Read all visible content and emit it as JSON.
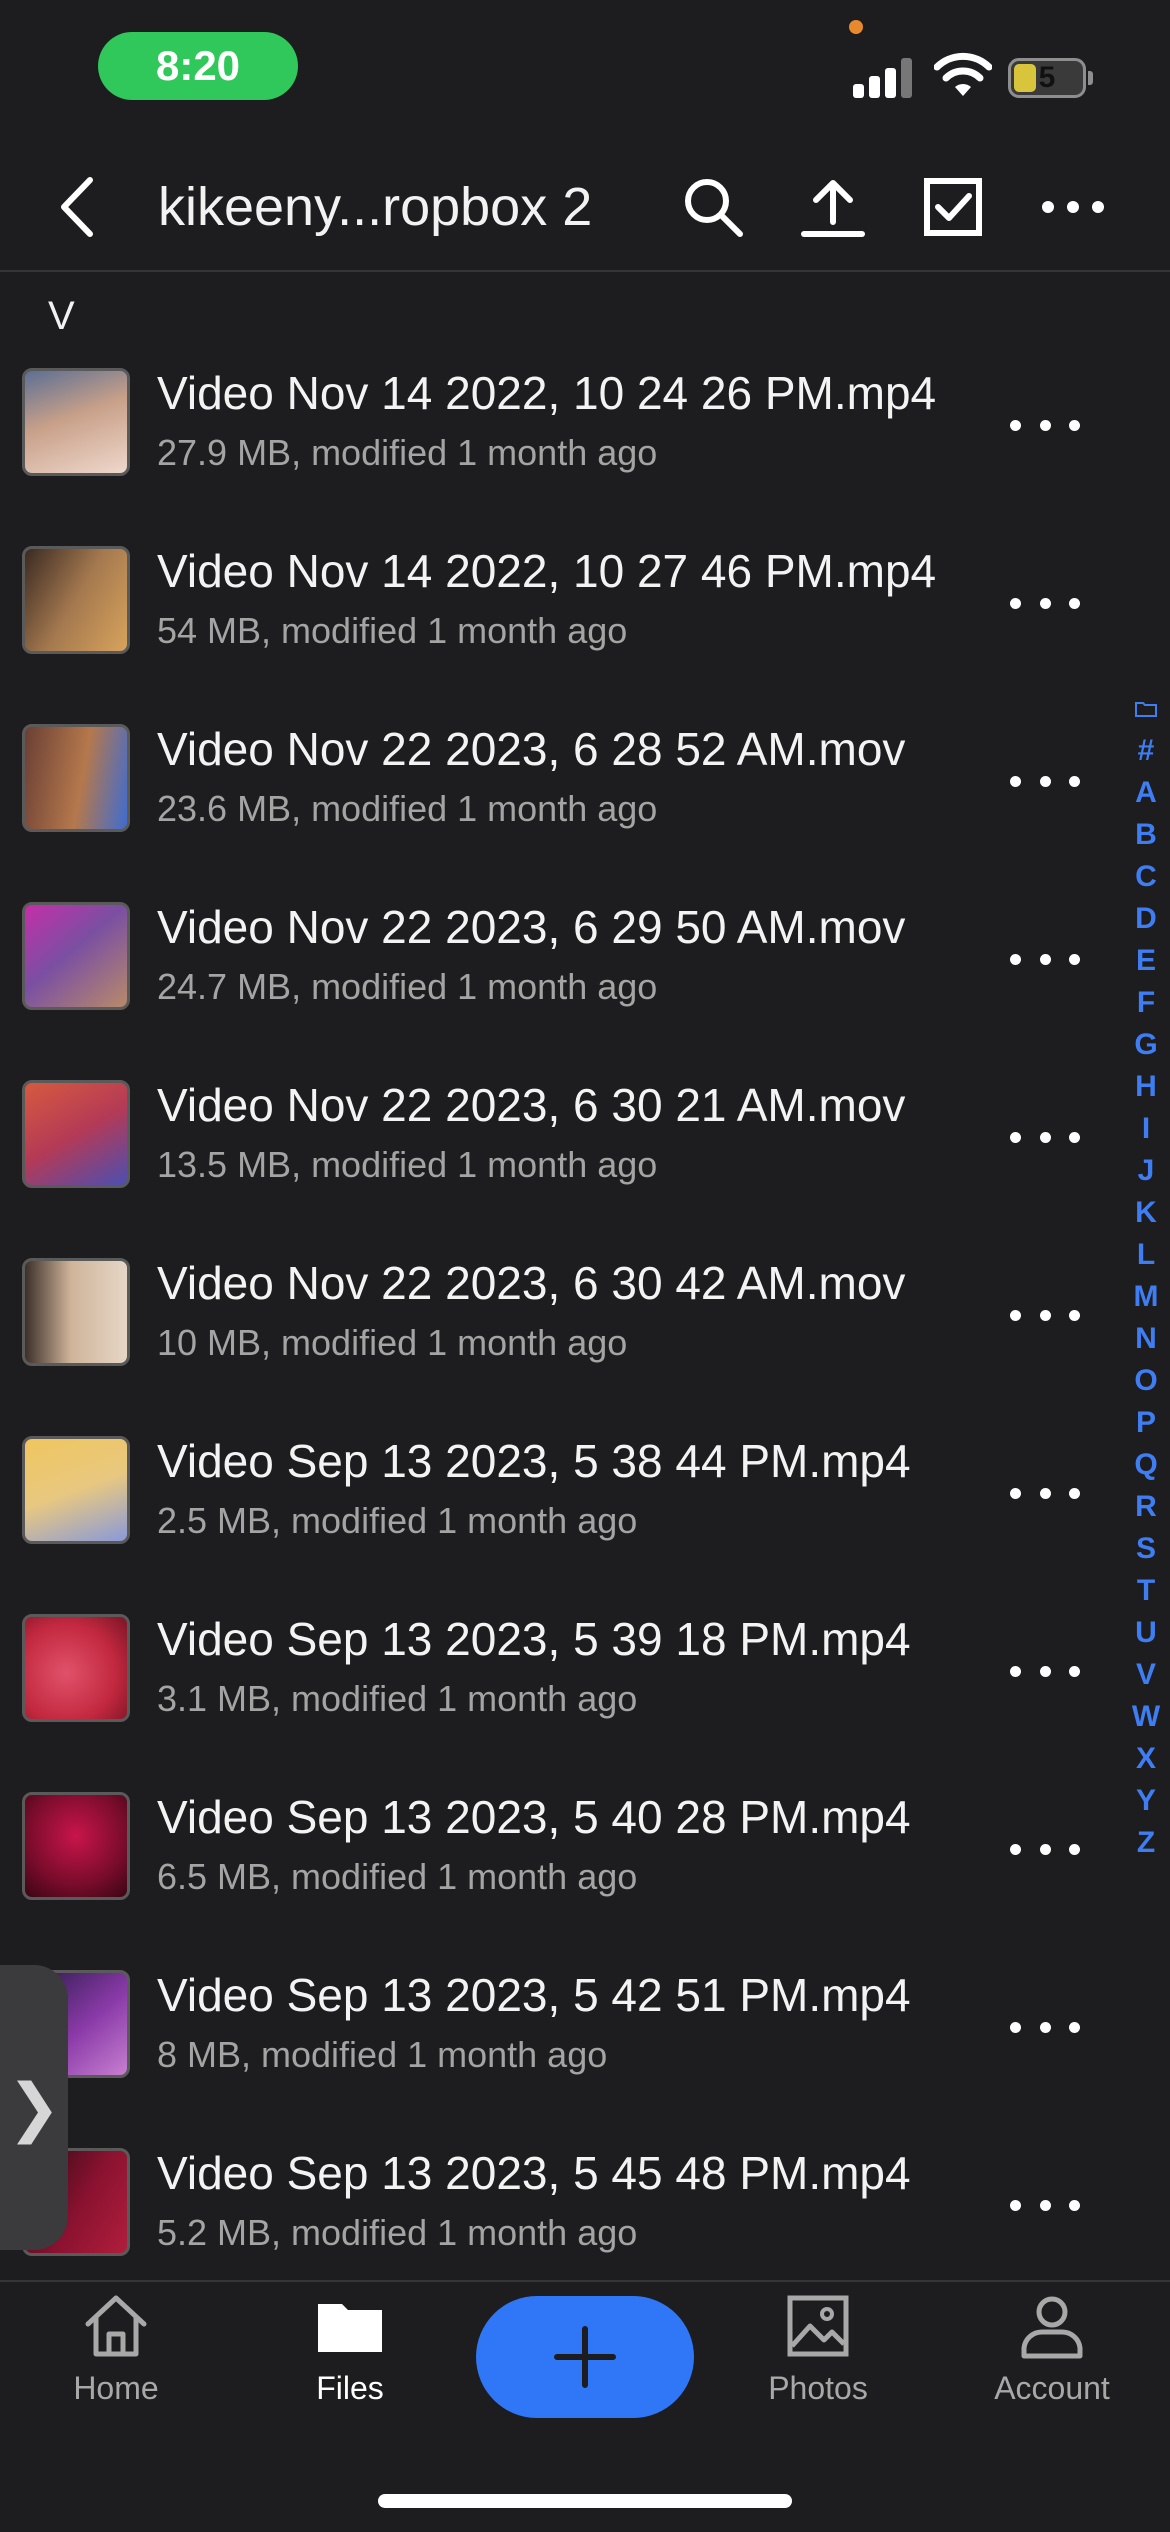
{
  "status_bar": {
    "time": "8:20",
    "battery_level": "5"
  },
  "navbar": {
    "title": "kikeeny...ropbox 2"
  },
  "section": {
    "letter": "V"
  },
  "files": [
    {
      "name": "Video Nov 14 2022, 10 24 26 PM.mp4",
      "meta": "27.9 MB, modified 1 month ago"
    },
    {
      "name": "Video Nov 14 2022, 10 27 46 PM.mp4",
      "meta": "54 MB, modified 1 month ago"
    },
    {
      "name": "Video Nov 22 2023, 6 28 52 AM.mov",
      "meta": "23.6 MB, modified 1 month ago"
    },
    {
      "name": "Video Nov 22 2023, 6 29 50 AM.mov",
      "meta": "24.7 MB, modified 1 month ago"
    },
    {
      "name": "Video Nov 22 2023, 6 30 21 AM.mov",
      "meta": "13.5 MB, modified 1 month ago"
    },
    {
      "name": "Video Nov 22 2023, 6 30 42 AM.mov",
      "meta": "10 MB, modified 1 month ago"
    },
    {
      "name": "Video Sep 13 2023, 5 38 44 PM.mp4",
      "meta": "2.5 MB, modified 1 month ago"
    },
    {
      "name": "Video Sep 13 2023, 5 39 18 PM.mp4",
      "meta": "3.1 MB, modified 1 month ago"
    },
    {
      "name": "Video Sep 13 2023, 5 40 28 PM.mp4",
      "meta": "6.5 MB, modified 1 month ago"
    },
    {
      "name": "Video Sep 13 2023, 5 42 51 PM.mp4",
      "meta": "8 MB, modified 1 month ago"
    },
    {
      "name": "Video Sep 13 2023, 5 45 48 PM.mp4",
      "meta": "5.2 MB, modified 1 month ago"
    }
  ],
  "alpha_index": [
    "#",
    "A",
    "B",
    "C",
    "D",
    "E",
    "F",
    "G",
    "H",
    "I",
    "J",
    "K",
    "L",
    "M",
    "N",
    "O",
    "P",
    "Q",
    "R",
    "S",
    "T",
    "U",
    "V",
    "W",
    "X",
    "Y",
    "Z"
  ],
  "side_tab": {
    "glyph": "❯"
  },
  "tabs": {
    "home": "Home",
    "files": "Files",
    "photos": "Photos",
    "account": "Account"
  },
  "colors": {
    "accent": "#2f77f6",
    "index": "#3f7df2",
    "time_pill": "#30c85a",
    "background": "#1d1c1e"
  }
}
